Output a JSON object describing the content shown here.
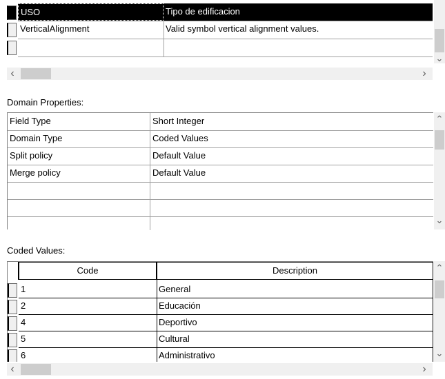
{
  "domains_table": {
    "rows": [
      {
        "name": "USO",
        "description": "Tipo de edificacion",
        "selected": true
      },
      {
        "name": "VerticalAlignment",
        "description": "Valid symbol vertical alignment values.",
        "selected": false
      },
      {
        "name": "",
        "description": "",
        "selected": false
      }
    ]
  },
  "domain_properties": {
    "label": "Domain Properties:",
    "rows": [
      {
        "property": "Field Type",
        "value": "Short Integer"
      },
      {
        "property": "Domain Type",
        "value": "Coded Values"
      },
      {
        "property": "Split policy",
        "value": "Default Value"
      },
      {
        "property": "Merge policy",
        "value": "Default Value"
      },
      {
        "property": "",
        "value": ""
      },
      {
        "property": "",
        "value": ""
      },
      {
        "property": "",
        "value": ""
      }
    ]
  },
  "coded_values": {
    "label": "Coded Values:",
    "headers": {
      "code": "Code",
      "description": "Description"
    },
    "rows": [
      {
        "code": "1",
        "description": "General"
      },
      {
        "code": "2",
        "description": "Educación"
      },
      {
        "code": "4",
        "description": "Deportivo"
      },
      {
        "code": "5",
        "description": "Cultural"
      },
      {
        "code": "6",
        "description": "Administrativo"
      }
    ]
  },
  "scroll_icons": {
    "up": "chevron-up-icon",
    "down": "chevron-down-icon",
    "left": "chevron-left-icon",
    "right": "chevron-right-icon"
  },
  "colors": {
    "selection": "#000000",
    "grid": "#a0a0a0",
    "scrollbar_track": "#f0f0f0",
    "scrollbar_thumb": "#cdcdcd"
  }
}
